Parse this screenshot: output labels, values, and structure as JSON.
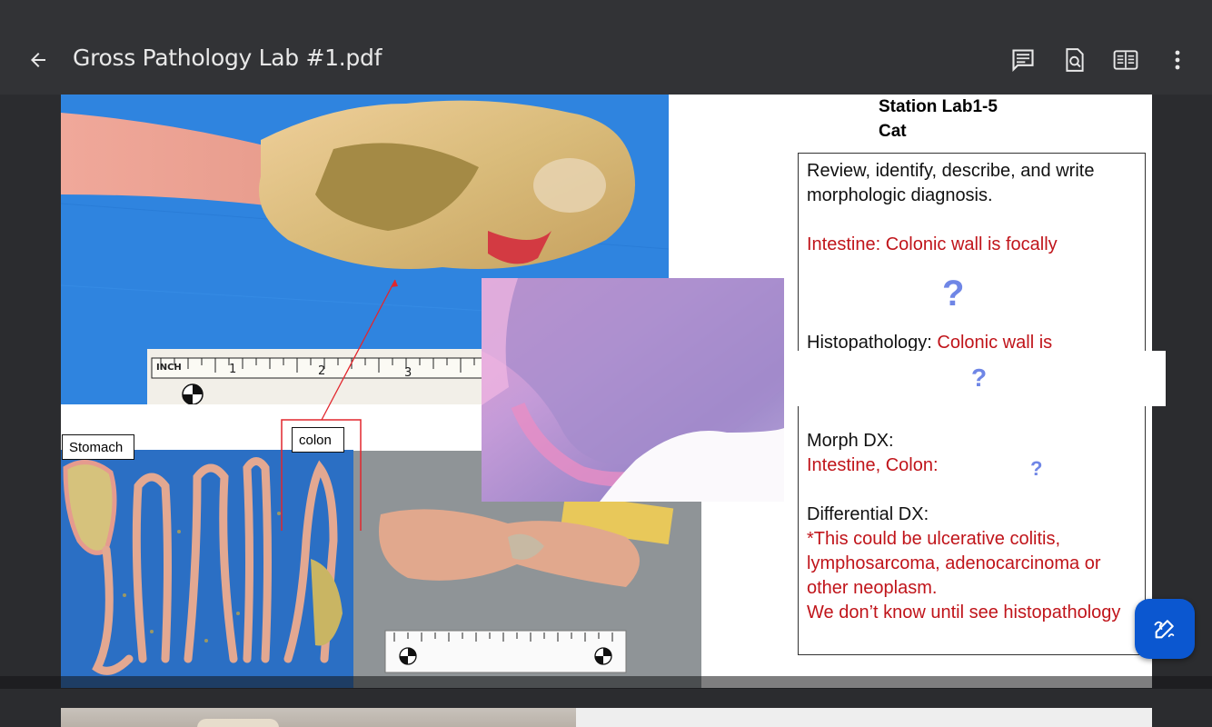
{
  "app": {
    "title": "Gross Pathology Lab #1.pdf",
    "icons": {
      "back": "arrow-back-icon",
      "comments": "comment-icon",
      "find": "find-in-page-icon",
      "reader": "reader-mode-icon",
      "more": "more-vert-icon",
      "edit": "draw-edit-icon"
    }
  },
  "slide": {
    "station_line1": "Station Lab1-5",
    "station_line2": "Cat",
    "labels": {
      "stomach": "Stomach",
      "colon": "colon"
    },
    "ruler": {
      "inch": "INCH",
      "n1": "1",
      "n2": "2",
      "n3": "3"
    },
    "panel": {
      "instruction_line1": "Review, identify, describe, and write",
      "instruction_line2": "morphologic diagnosis.",
      "intestine_prefix": "Intestine: Colonic wall is focally",
      "question1": "?",
      "histo_label": "Histopathology: ",
      "histo_value": "Colonic wall is",
      "question2": "?",
      "morph_label": "Morph DX:",
      "morph_value": "Intestine, Colon:",
      "question3": "?",
      "diff_label": "Differential DX:",
      "diff_line1": "*This could be ulcerative colitis,",
      "diff_line2": "lymphosarcoma, adenocarcinoma or",
      "diff_line3": "other neoplasm.",
      "diff_line4": "We don’t know until see histopathology"
    }
  },
  "colors": {
    "topbar": "#323336",
    "background": "#2b2c2f",
    "red_text": "#c0141a",
    "question_mark": "#6f86e6",
    "fab": "#0b57d0"
  }
}
